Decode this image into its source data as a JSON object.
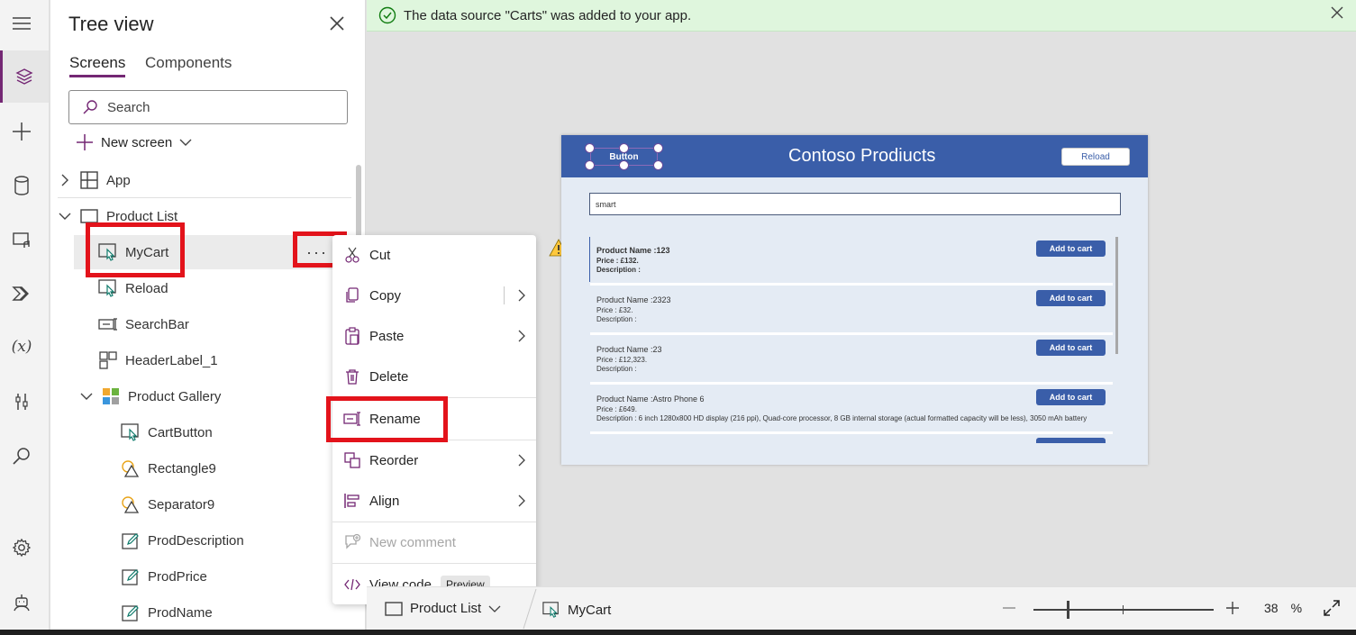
{
  "tree": {
    "title": "Tree view",
    "tabs": {
      "screens": "Screens",
      "components": "Components"
    },
    "search_placeholder": "Search",
    "new_screen": "New screen",
    "nodes": {
      "app": "App",
      "product_list": "Product List",
      "mycart": "MyCart",
      "reload": "Reload",
      "searchbar": "SearchBar",
      "headerlabel": "HeaderLabel_1",
      "product_gallery": "Product Gallery",
      "cartbutton": "CartButton",
      "rectangle9": "Rectangle9",
      "separator9": "Separator9",
      "proddescription": "ProdDescription",
      "prodprice": "ProdPrice",
      "prodname": "ProdName"
    },
    "more_label": "···"
  },
  "notification": {
    "text": "The data source \"Carts\" was added to your app."
  },
  "context_menu": {
    "cut": "Cut",
    "copy": "Copy",
    "paste": "Paste",
    "delete": "Delete",
    "rename": "Rename",
    "reorder": "Reorder",
    "align": "Align",
    "new_comment": "New comment",
    "view_code": "View code",
    "preview_badge": "Preview"
  },
  "app_canvas": {
    "title": "Contoso Prodiucts",
    "selected_button": "Button",
    "reload_button": "Reload",
    "search_value": "smart",
    "add_to_cart": "Add to cart",
    "items": [
      {
        "name": "Product Name :123",
        "price": "Price :   £132.",
        "description": "Description :"
      },
      {
        "name": "Product Name :2323",
        "price": "Price :   £32.",
        "description": "Description :"
      },
      {
        "name": "Product Name :23",
        "price": "Price :   £12,323.",
        "description": "Description :"
      },
      {
        "name": "Product Name :Astro Phone 6",
        "price": "Price :   £649.",
        "description": "Description :   6 inch 1280x800 HD display (216 ppi), Quad-core processor, 8 GB internal storage (actual formatted capacity will be less), 3050 mAh battery"
      }
    ]
  },
  "bottom_bar": {
    "screen": "Product List",
    "control": "MyCart",
    "zoom_value": "38",
    "zoom_unit": "%",
    "zoom_fraction": 0.38
  },
  "colors": {
    "accent": "#742774",
    "header_blue": "#3a5ea9",
    "highlight_red": "#e3131b",
    "notif_green": "#dff6dd"
  }
}
